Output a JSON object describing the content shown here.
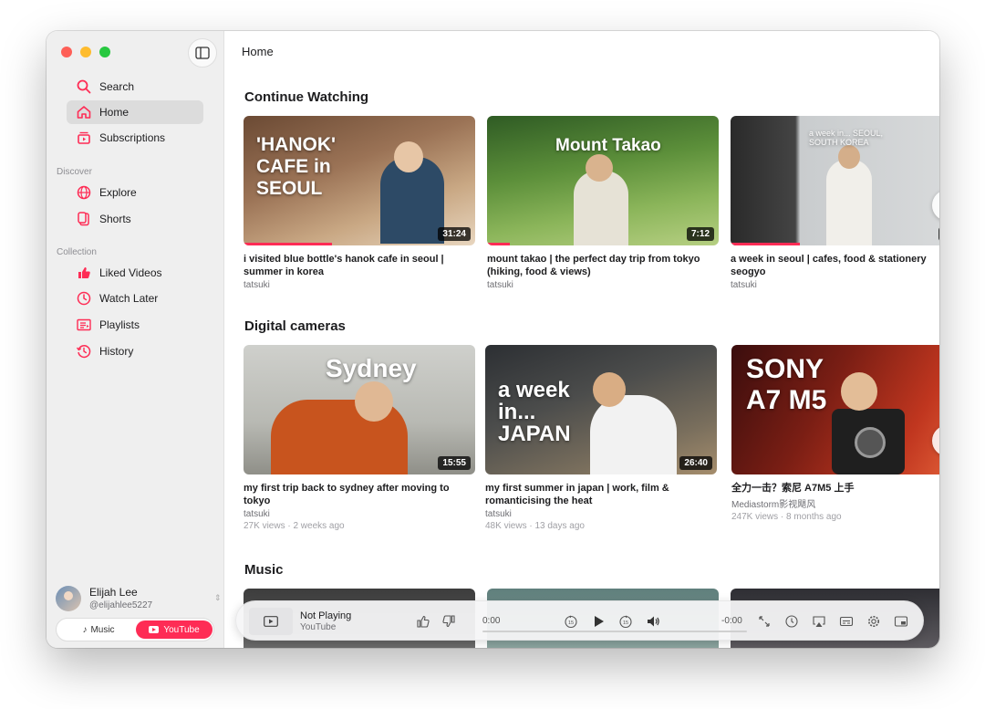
{
  "sidebar": {
    "items": [
      {
        "label": "Search"
      },
      {
        "label": "Home"
      },
      {
        "label": "Subscriptions"
      }
    ],
    "discover_label": "Discover",
    "discover": [
      {
        "label": "Explore"
      },
      {
        "label": "Shorts"
      }
    ],
    "collection_label": "Collection",
    "collection": [
      {
        "label": "Liked Videos"
      },
      {
        "label": "Watch Later"
      },
      {
        "label": "Playlists"
      },
      {
        "label": "History"
      }
    ],
    "user": {
      "name": "Elijah Lee",
      "handle": "@elijahlee5227"
    },
    "switcher": {
      "music": "Music",
      "youtube": "YouTube"
    }
  },
  "main": {
    "title": "Home",
    "sections": [
      {
        "title": "Continue Watching",
        "cards": [
          {
            "title": "i visited blue bottle's hanok cafe in seoul | summer in korea",
            "channel": "tatsuki",
            "duration": "31:24",
            "progress": 0.38,
            "overlay": "'HANOK' CAFE in SEOUL"
          },
          {
            "title": "mount takao | the perfect day trip from tokyo (hiking, food & views)",
            "channel": "tatsuki",
            "duration": "7:12",
            "progress": 0.1,
            "overlay": "Mount Takao"
          },
          {
            "title": "a week in seoul | cafes, food & stationery",
            "subtitle2": "seogyo",
            "channel": "tatsuki",
            "duration": "24",
            "progress": 0.3,
            "overlay": "a week in... SEOUL, SOUTH KOREA"
          }
        ]
      },
      {
        "title": "Digital cameras",
        "cards": [
          {
            "title": "my first trip back to sydney after moving to tokyo",
            "channel": "tatsuki",
            "meta": "27K views · 2 weeks ago",
            "duration": "15:55",
            "overlay": "Sydney"
          },
          {
            "title": "my first summer in japan | work, film & romanticising the heat",
            "channel": "tatsuki",
            "meta": "48K views · 13 days ago",
            "duration": "26:40",
            "overlay": "a week in... JAPAN"
          },
          {
            "title": "全力一击？索尼 A7M5 上手",
            "channel": "Mediastorm影视飓风",
            "meta": "247K views · 8 months ago",
            "duration": "18",
            "overlay": "SONY A7 M5"
          }
        ]
      },
      {
        "title": "Music"
      }
    ]
  },
  "player": {
    "title": "Not Playing",
    "subtitle": "YouTube",
    "time_elapsed": "0:00",
    "time_remaining": "-0:00"
  },
  "colors": {
    "accent": "#fe2c55",
    "sidebar_bg": "#efefef"
  }
}
